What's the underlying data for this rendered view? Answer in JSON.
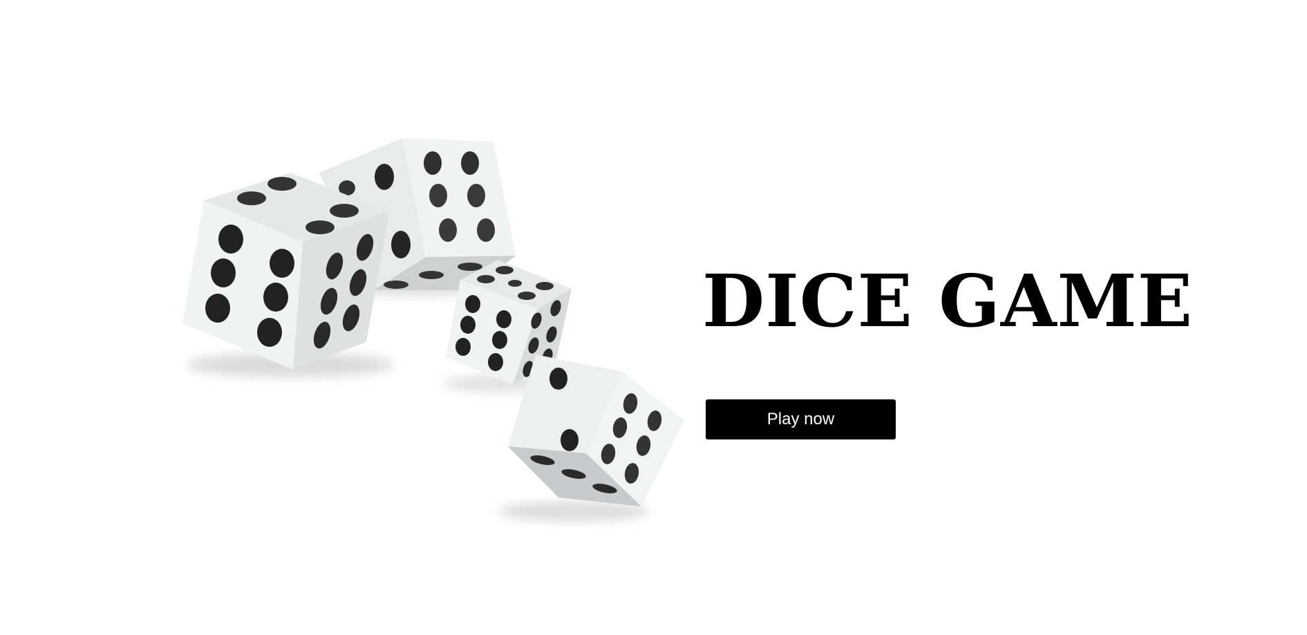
{
  "title": "DICE GAME",
  "play_button_label": "Play now",
  "dice_illustration": {
    "icon": "dice-icon",
    "dice": [
      {
        "name": "die-1",
        "top_pips": 4,
        "front_pips": 6,
        "side_pips": 6
      },
      {
        "name": "die-2",
        "top_pips": 6,
        "front_pips": 3,
        "side_pips": 6
      },
      {
        "name": "die-3",
        "top_pips": 5,
        "front_pips": 6,
        "side_pips": 6
      },
      {
        "name": "die-4",
        "top_pips": 2,
        "front_pips": 6,
        "side_pips": 3
      }
    ]
  },
  "colors": {
    "background": "#ffffff",
    "title": "#000000",
    "button_bg": "#000000",
    "button_text": "#ffffff",
    "pip": "#2b2b2b",
    "die_face_light": "#f1f2f2",
    "die_face_shade": "#d4d5d5"
  }
}
